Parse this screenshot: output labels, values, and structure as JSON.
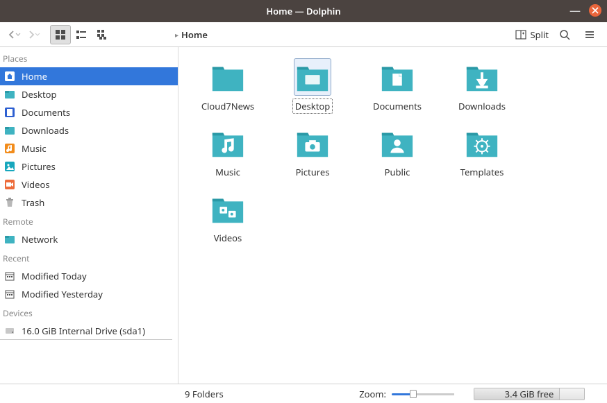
{
  "window": {
    "title": "Home — Dolphin"
  },
  "toolbar": {
    "split_label": "Split"
  },
  "breadcrumb": {
    "current": "Home"
  },
  "sidebar": {
    "sections": {
      "places": {
        "header": "Places",
        "items": [
          {
            "label": "Home",
            "icon": "home"
          },
          {
            "label": "Desktop",
            "icon": "folder-teal"
          },
          {
            "label": "Documents",
            "icon": "document-blue"
          },
          {
            "label": "Downloads",
            "icon": "folder-teal"
          },
          {
            "label": "Music",
            "icon": "music-orange"
          },
          {
            "label": "Pictures",
            "icon": "pictures-teal"
          },
          {
            "label": "Videos",
            "icon": "videos-orange"
          },
          {
            "label": "Trash",
            "icon": "trash"
          }
        ]
      },
      "remote": {
        "header": "Remote",
        "items": [
          {
            "label": "Network",
            "icon": "folder-teal"
          }
        ]
      },
      "recent": {
        "header": "Recent",
        "items": [
          {
            "label": "Modified Today",
            "icon": "calendar"
          },
          {
            "label": "Modified Yesterday",
            "icon": "calendar"
          }
        ]
      },
      "devices": {
        "header": "Devices",
        "items": [
          {
            "label": "16.0 GiB Internal Drive (sda1)",
            "icon": "drive"
          }
        ]
      }
    }
  },
  "folders": [
    {
      "label": "Cloud7News",
      "glyph": ""
    },
    {
      "label": "Desktop",
      "glyph": "desktop",
      "selected": true
    },
    {
      "label": "Documents",
      "glyph": "document"
    },
    {
      "label": "Downloads",
      "glyph": "download"
    },
    {
      "label": "Music",
      "glyph": "music"
    },
    {
      "label": "Pictures",
      "glyph": "camera"
    },
    {
      "label": "Public",
      "glyph": "person"
    },
    {
      "label": "Templates",
      "glyph": "template"
    },
    {
      "label": "Videos",
      "glyph": "video"
    }
  ],
  "status": {
    "summary": "9 Folders",
    "zoom_label": "Zoom:",
    "free_space": "3.4 GiB free"
  },
  "colors": {
    "accent": "#3277db",
    "folder": "#3fb3c1",
    "folder_dark": "#2a99a6"
  }
}
